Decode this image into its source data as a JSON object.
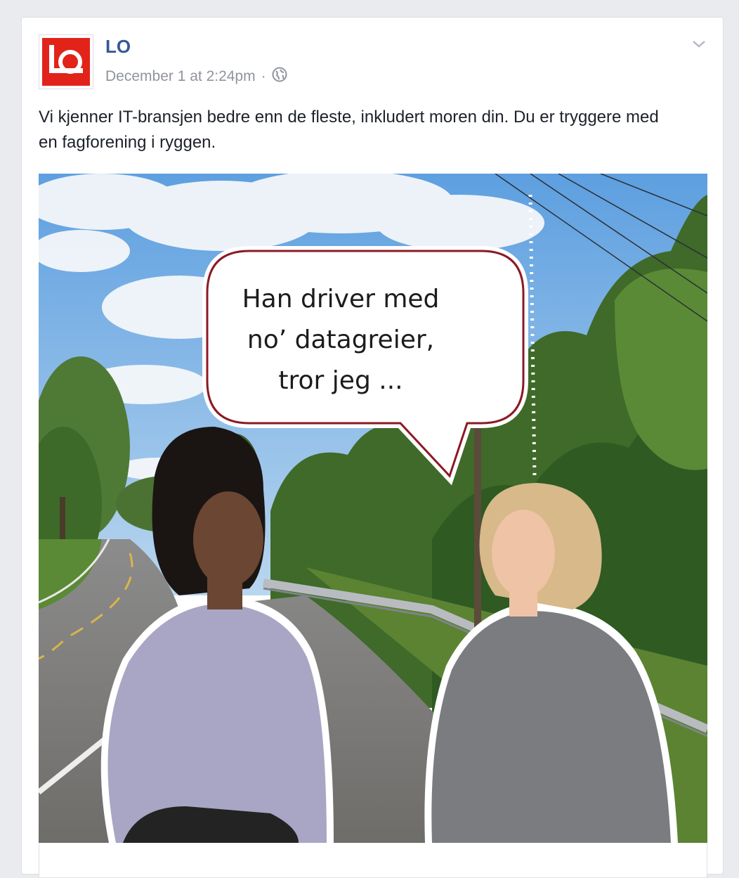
{
  "post": {
    "author": "LO",
    "timestamp": "December 1 at 2:24pm",
    "separator": "·",
    "privacy_icon": "globe-icon",
    "menu_icon": "chevron-down-icon",
    "text": "Vi kjenner IT-bransjen bedre enn de fleste, inkludert moren din. Du er tryggere med en fagforening i ryggen."
  },
  "image": {
    "speech_bubble": {
      "line1": "Han driver med",
      "line2": "no’ datagreier,",
      "line3": "tror jeg ..."
    }
  },
  "colors": {
    "brand_red": "#e2231a",
    "link_blue": "#365899",
    "meta_gray": "#90949c",
    "bubble_border": "#8b1a24"
  }
}
